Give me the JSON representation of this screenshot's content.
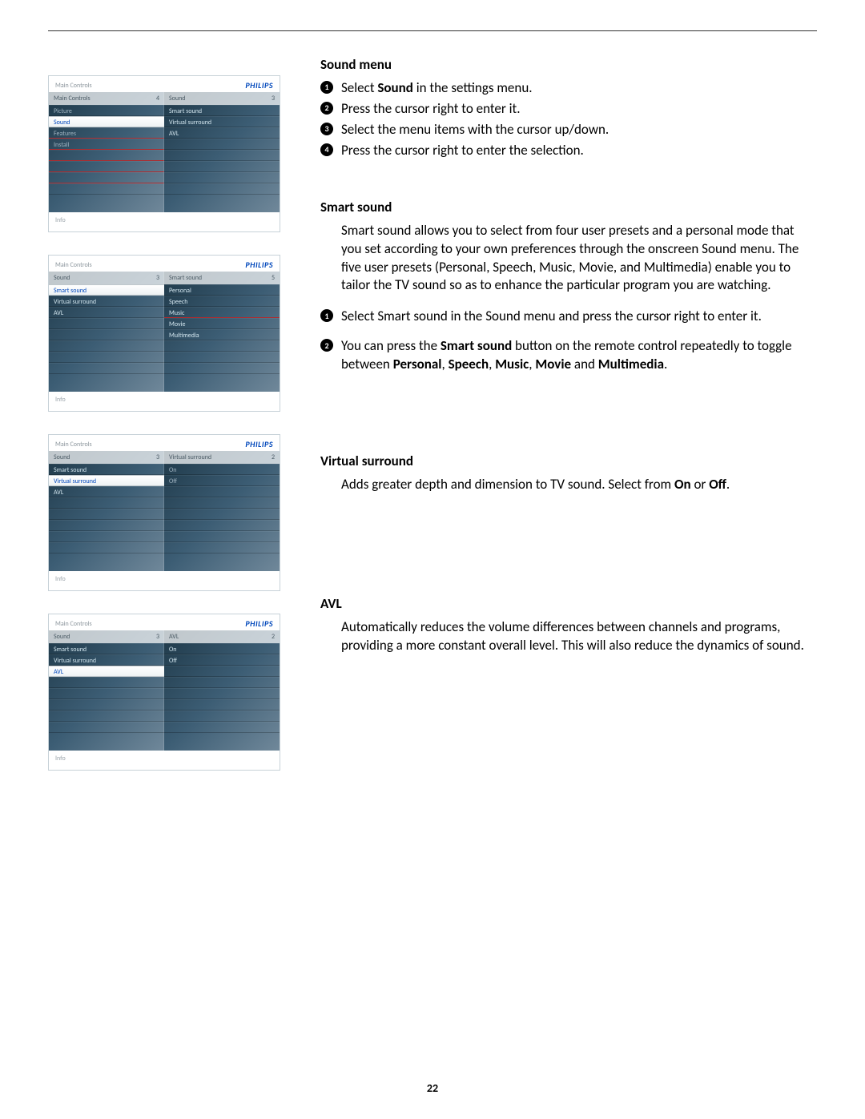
{
  "page_number": "22",
  "brand": "PHILIPS",
  "tv1": {
    "header_left": "Main Controls",
    "left_title": {
      "label": "Main Controls",
      "count": "4"
    },
    "right_title": {
      "label": "Sound",
      "count": "3"
    },
    "left_rows": [
      "Picture",
      "Sound",
      "Features",
      "Install"
    ],
    "right_rows": [
      "Smart sound",
      "Virtual surround",
      "AVL"
    ],
    "info": "Info"
  },
  "tv2": {
    "header_left": "Main Controls",
    "left_title": {
      "label": "Sound",
      "count": "3"
    },
    "right_title": {
      "label": "Smart sound",
      "count": "5"
    },
    "left_rows": [
      "Smart sound",
      "Virtual surround",
      "AVL"
    ],
    "right_rows": [
      "Personal",
      "Speech",
      "Music",
      "Movie",
      "Multimedia"
    ],
    "info": "Info"
  },
  "tv3": {
    "header_left": "Main Controls",
    "left_title": {
      "label": "Sound",
      "count": "3"
    },
    "right_title": {
      "label": "Virtual surround",
      "count": "2"
    },
    "left_rows": [
      "Smart sound",
      "Virtual surround",
      "AVL"
    ],
    "right_rows": [
      "On",
      "Off"
    ],
    "info": "Info"
  },
  "tv4": {
    "header_left": "Main Controls",
    "left_title": {
      "label": "Sound",
      "count": "3"
    },
    "right_title": {
      "label": "AVL",
      "count": "2"
    },
    "left_rows": [
      "Smart sound",
      "Virtual surround",
      "AVL"
    ],
    "right_rows": [
      "On",
      "Off"
    ],
    "info": "Info"
  },
  "sec1": {
    "title": "Sound menu",
    "steps": [
      {
        "n": "1",
        "pre": "Select ",
        "bold": "Sound",
        "post": " in the settings menu."
      },
      {
        "n": "2",
        "pre": "Press the cursor right to enter it.",
        "bold": "",
        "post": ""
      },
      {
        "n": "3",
        "pre": "Select the menu items with the cursor up/down.",
        "bold": "",
        "post": ""
      },
      {
        "n": "4",
        "pre": "Press the cursor right to enter the selection.",
        "bold": "",
        "post": ""
      }
    ]
  },
  "sec2": {
    "title": "Smart sound",
    "body": "Smart sound allows you to select from four user presets and a personal mode that you set according to your own preferences through the onscreen Sound menu.  The five user presets (Personal, Speech, Music, Movie, and Multimedia) enable you to tailor the TV sound so as to enhance the particular program you are watching.",
    "steps": [
      {
        "n": "1",
        "html": "Select Smart sound in the Sound menu and press the cursor right to enter it."
      },
      {
        "n": "2",
        "html": "You can press the <b>Smart sound</b> button on the remote control repeatedly to toggle between <b>Personal</b>, <b>Speech</b>, <b>Music</b>, <b>Movie</b> and <b>Multimedia</b>."
      }
    ]
  },
  "sec3": {
    "title": "Virtual surround",
    "body_html": "Adds greater depth and dimension to TV sound.  Select from <b>On</b> or <b>Off</b>."
  },
  "sec4": {
    "title": "AVL",
    "body": "Automatically reduces the volume differences between channels and programs, providing a more constant overall level.  This will also reduce the dynamics of sound."
  }
}
